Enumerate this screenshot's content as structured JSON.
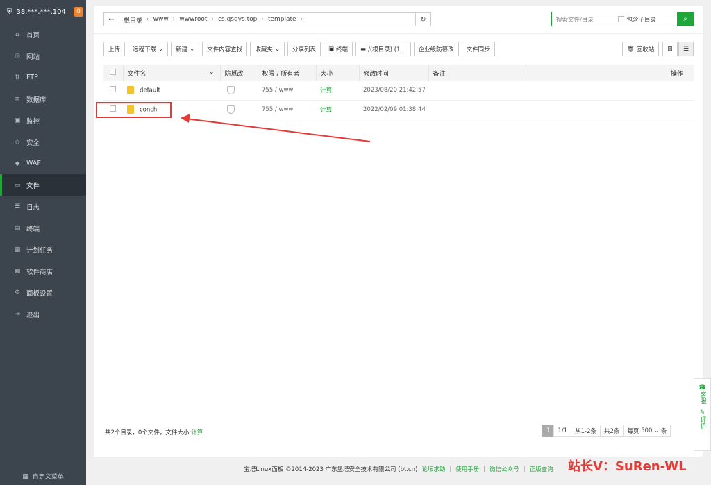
{
  "sidebar": {
    "server": "38.***.***.104",
    "badge": "0",
    "items": [
      {
        "label": "首页",
        "icon": "home-icon",
        "glyph": "⌂"
      },
      {
        "label": "网站",
        "icon": "globe-icon",
        "glyph": "◎"
      },
      {
        "label": "FTP",
        "icon": "ftp-icon",
        "glyph": "⇅"
      },
      {
        "label": "数据库",
        "icon": "database-icon",
        "glyph": "≡"
      },
      {
        "label": "监控",
        "icon": "monitor-icon",
        "glyph": "▣"
      },
      {
        "label": "安全",
        "icon": "shield-icon",
        "glyph": "◇"
      },
      {
        "label": "WAF",
        "icon": "waf-icon",
        "glyph": "◆"
      },
      {
        "label": "文件",
        "icon": "folder-icon",
        "glyph": "▭"
      },
      {
        "label": "日志",
        "icon": "log-icon",
        "glyph": "☰"
      },
      {
        "label": "终端",
        "icon": "terminal-icon",
        "glyph": "▤"
      },
      {
        "label": "计划任务",
        "icon": "calendar-icon",
        "glyph": "▦"
      },
      {
        "label": "软件商店",
        "icon": "grid-icon",
        "glyph": "▩"
      },
      {
        "label": "面板设置",
        "icon": "gear-icon",
        "glyph": "⚙"
      },
      {
        "label": "退出",
        "icon": "logout-icon",
        "glyph": "⇥"
      }
    ],
    "custom_menu": "自定义菜单"
  },
  "path": {
    "crumbs": [
      "根目录",
      "www",
      "wwwroot",
      "cs.qsgys.top",
      "template"
    ]
  },
  "search": {
    "placeholder": "搜索文件/目录",
    "subdir_label": "包含子目录"
  },
  "toolbar": {
    "upload": "上传",
    "remote_download": "远程下载",
    "new": "新建",
    "content_search": "文件内容查找",
    "favorites": "收藏夹",
    "share_list": "分享列表",
    "terminal": "终端",
    "disk": "/(根目录) (1...",
    "enterprise_protect": "企业级防篡改",
    "file_sync": "文件同步",
    "recycle": "回收站"
  },
  "table": {
    "headers": [
      "文件名",
      "防篡改",
      "权限 / 所有者",
      "大小",
      "修改时间",
      "备注",
      "操作"
    ],
    "rows": [
      {
        "name": "default",
        "perm": "755 / www",
        "size": "计算",
        "mtime": "2023/08/20 21:42:57"
      },
      {
        "name": "conch",
        "perm": "755 / www",
        "size": "计算",
        "mtime": "2022/02/09 01:38:44"
      }
    ]
  },
  "summary": {
    "text": "共2个目录，0个文件，文件大小:",
    "calc": "计算"
  },
  "pager": {
    "current": "1",
    "pages": "1/1",
    "range": "从1-2条",
    "total": "共2条",
    "per_page_label": "每页",
    "per_page": "500",
    "unit": "条"
  },
  "footer": {
    "copyright": "宝塔Linux面板 ©2014-2023 广东堡塔安全技术有限公司 (bt.cn)",
    "links": [
      "论坛求助",
      "使用手册",
      "微信公众号",
      "正版查询"
    ]
  },
  "float": {
    "service": "客服",
    "review": "评价"
  },
  "watermark": "站长V：SuRen-WL",
  "colors": {
    "accent": "#20a53a",
    "sidebar": "#3c444d",
    "annotation": "#e53935"
  }
}
